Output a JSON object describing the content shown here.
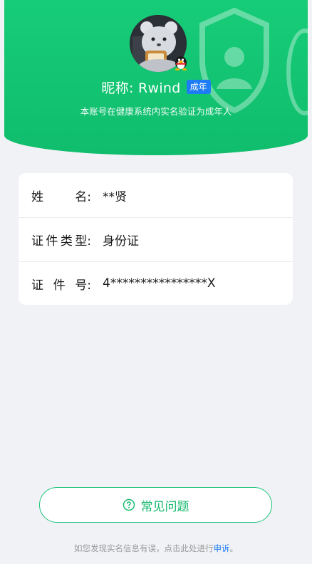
{
  "header": {
    "nickname_label": "昵称: Rwind",
    "badge": "成年",
    "verify_text": "本账号在健康系统内实名验证为成年人"
  },
  "info": {
    "rows": [
      {
        "label_chars": [
          "姓",
          "名:"
        ],
        "value": "**贤"
      },
      {
        "label_chars": [
          "证",
          "件",
          "类",
          "型:"
        ],
        "value": "身份证"
      },
      {
        "label_chars": [
          "证",
          "件",
          "号:"
        ],
        "value": "4****************X"
      }
    ]
  },
  "faq": {
    "label": "常见问题"
  },
  "footer": {
    "text": "如您发现实名信息有误，点击此处进行",
    "link": "申诉",
    "end": "。"
  },
  "colors": {
    "primary_green": "#17cc78",
    "badge_blue": "#1e7df5"
  }
}
